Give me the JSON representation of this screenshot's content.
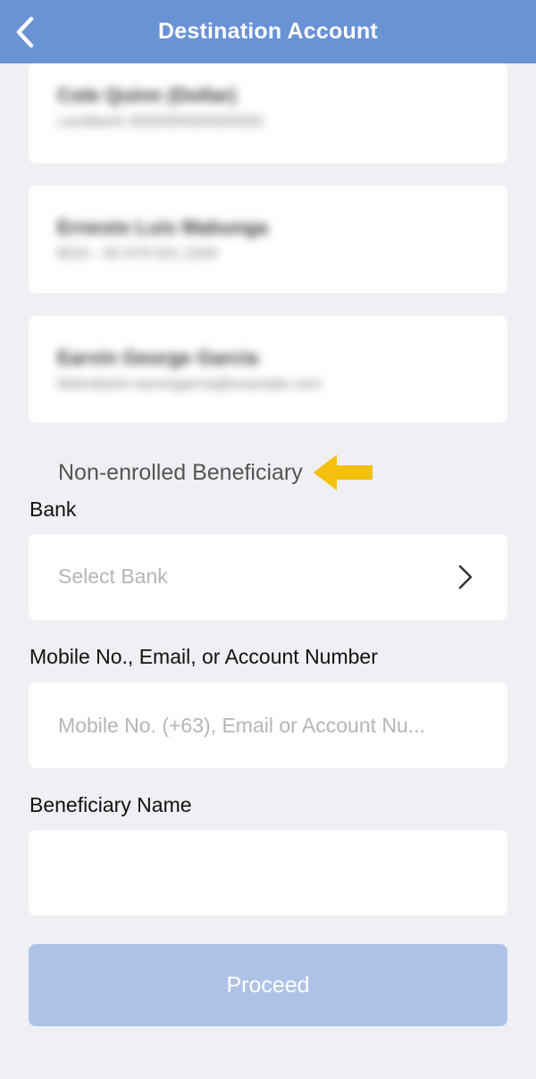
{
  "header": {
    "title": "Destination Account",
    "back_icon": "chevron-left-icon"
  },
  "enrolled_accounts": [
    {
      "name": "Cole Quinn (Dollar)",
      "detail": "Landbank 0000000000000000"
    },
    {
      "name": "Ernesto Luis Mabunga",
      "detail": "BDO - 00 979 501 2200"
    },
    {
      "name": "Earvin George Garcia",
      "detail": "Metrobank earvingarcia@example.com"
    }
  ],
  "non_enrolled": {
    "section_label": "Non-enrolled Beneficiary",
    "arrow_icon": "arrow-left-icon",
    "arrow_color": "#f5bf0d"
  },
  "form": {
    "bank_label": "Bank",
    "bank_placeholder": "Select Bank",
    "bank_icon": "chevron-right-icon",
    "account_label": "Mobile No., Email, or Account Number",
    "account_placeholder": "Mobile No. (+63), Email or Account Nu...",
    "beneficiary_label": "Beneficiary Name",
    "beneficiary_value": ""
  },
  "proceed_label": "Proceed",
  "colors": {
    "header": "#6a93d6",
    "background": "#efeff4",
    "proceed_disabled": "#aec2e6"
  }
}
